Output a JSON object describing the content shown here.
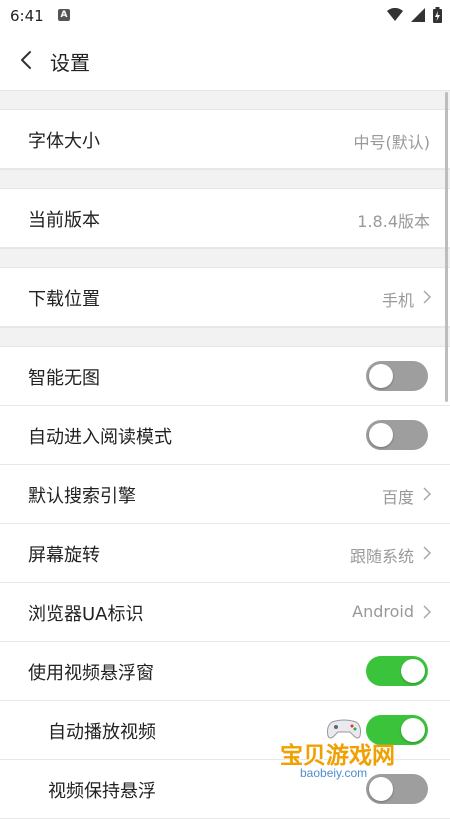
{
  "status_bar": {
    "time": "6:41"
  },
  "header": {
    "title": "设置"
  },
  "settings": [
    {
      "label": "字体大小",
      "value": "中号(默认)"
    },
    {
      "label": "当前版本",
      "value": "1.8.4版本"
    },
    {
      "label": "下载位置",
      "value": "手机"
    },
    {
      "label": "智能无图",
      "toggle": false
    },
    {
      "label": "自动进入阅读模式",
      "toggle": false
    },
    {
      "label": "默认搜索引擎",
      "value": "百度"
    },
    {
      "label": "屏幕旋转",
      "value": "跟随系统"
    },
    {
      "label": "浏览器UA标识",
      "value": "Android"
    },
    {
      "label": "使用视频悬浮窗",
      "toggle": true
    },
    {
      "label": "自动播放视频",
      "toggle": true
    },
    {
      "label": "视频保持悬浮",
      "toggle": false
    }
  ],
  "watermark": {
    "text": "宝贝游戏网",
    "url": "baobeiy.com"
  },
  "colors": {
    "toggle_on": "#3bc43b",
    "toggle_off": "#9e9e9e",
    "watermark": "#f0a000"
  }
}
